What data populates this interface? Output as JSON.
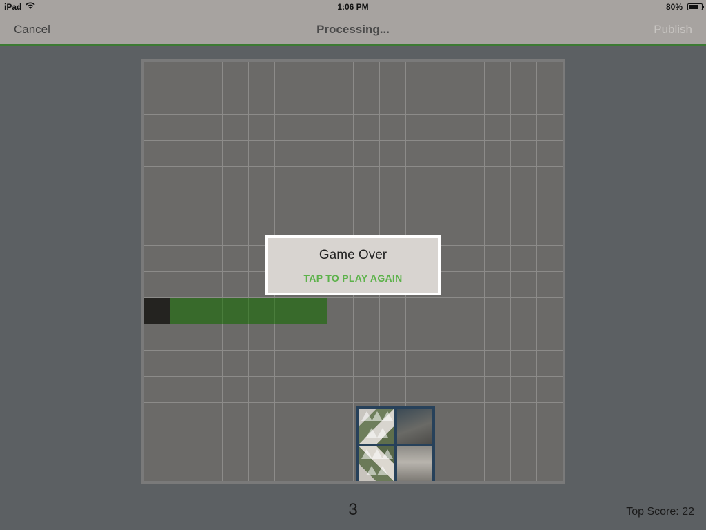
{
  "status_bar": {
    "device": "iPad",
    "time": "1:06 PM",
    "battery_percent": "80%",
    "battery_level": 0.8
  },
  "nav": {
    "cancel_label": "Cancel",
    "title": "Processing...",
    "publish_label": "Publish"
  },
  "game": {
    "grid_columns": 16,
    "grid_rows": 16,
    "snake_head_cell": [
      0,
      9
    ],
    "snake_body_cells": [
      [
        1,
        9
      ],
      [
        2,
        9
      ],
      [
        3,
        9
      ],
      [
        4,
        9
      ],
      [
        5,
        9
      ],
      [
        6,
        9
      ]
    ],
    "food_cells": [
      [
        8,
        13
      ],
      [
        9,
        13
      ],
      [
        8,
        14
      ],
      [
        9,
        14
      ],
      [
        8,
        15
      ],
      [
        9,
        15
      ]
    ]
  },
  "dialog": {
    "title": "Game Over",
    "action": "TAP TO PLAY AGAIN"
  },
  "score": {
    "current": "3",
    "top": "Top Score: 22"
  },
  "colors": {
    "accent_green": "#5cb24a",
    "snake_body": "#386a2b",
    "snake_head": "#242320"
  }
}
